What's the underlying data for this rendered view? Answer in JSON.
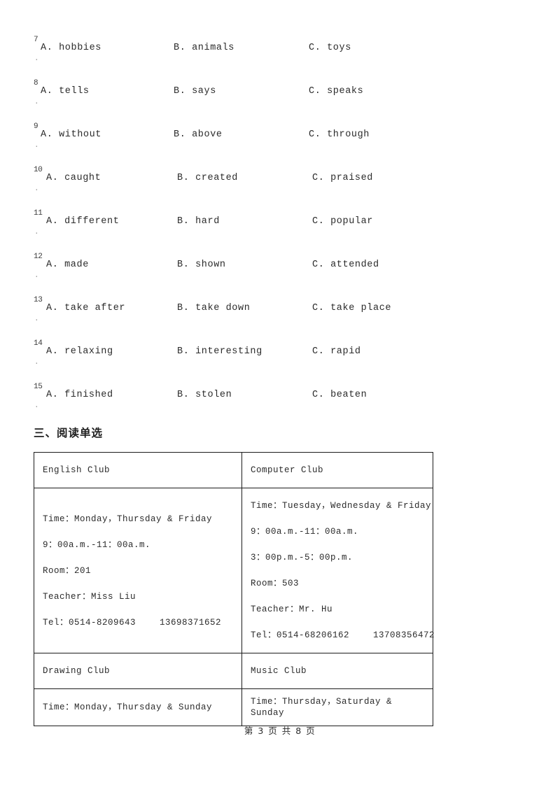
{
  "cloze_options": [
    {
      "number": "7",
      "wide": false,
      "a": "A. hobbies",
      "b": "B. animals",
      "c": "C. toys"
    },
    {
      "number": "8",
      "wide": false,
      "a": "A. tells",
      "b": "B. says",
      "c": "C. speaks"
    },
    {
      "number": "9",
      "wide": false,
      "a": "A. without",
      "b": "B. above",
      "c": "C. through"
    },
    {
      "number": "10",
      "wide": true,
      "a": "A. caught",
      "b": "B. created",
      "c": "C. praised"
    },
    {
      "number": "11",
      "wide": true,
      "a": "A. different",
      "b": "B. hard",
      "c": "C. popular"
    },
    {
      "number": "12",
      "wide": true,
      "a": "A. made",
      "b": "B. shown",
      "c": "C. attended"
    },
    {
      "number": "13",
      "wide": true,
      "a": "A. take after",
      "b": "B. take down",
      "c": "C. take place"
    },
    {
      "number": "14",
      "wide": true,
      "a": "A. relaxing",
      "b": "B. interesting",
      "c": "C. rapid"
    },
    {
      "number": "15",
      "wide": true,
      "a": "A. finished",
      "b": "B. stolen",
      "c": "C. beaten"
    }
  ],
  "marker_dot": ".",
  "section": {
    "heading": "三、阅读单选"
  },
  "clubs_table": {
    "row1": {
      "left_title": "English Club",
      "right_title": "Computer Club"
    },
    "row2": {
      "left_lines": [
        "Time：Monday，Thursday & Friday",
        "9：00a.m.-11：00a.m.",
        "Room：201",
        "Teacher：Miss Liu"
      ],
      "left_tel_label": "Tel：0514-8209643",
      "left_tel_mobile": "13698371652",
      "right_lines": [
        "Time：Tuesday，Wednesday & Friday",
        "9：00a.m.-11：00a.m.",
        "3：00p.m.-5：00p.m.",
        "Room：503",
        "Teacher：Mr. Hu"
      ],
      "right_tel_label": "Tel：0514-68206162",
      "right_tel_mobile": "13708356472"
    },
    "row3": {
      "left_title": "Drawing Club",
      "right_title": "Music Club"
    },
    "row4": {
      "left_time": "Time：Monday，Thursday & Sunday",
      "right_time": "Time：Thursday，Saturday & Sunday"
    }
  },
  "footer": {
    "page_text": "第 3 页 共 8 页"
  }
}
